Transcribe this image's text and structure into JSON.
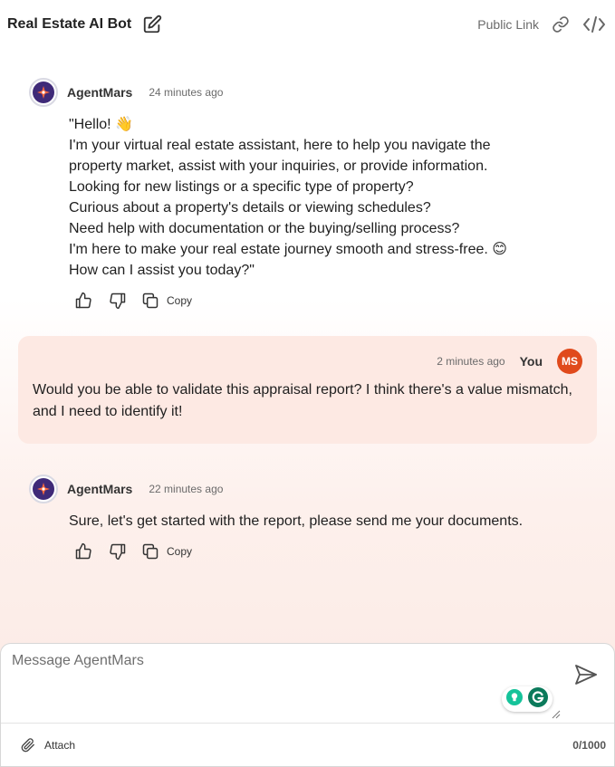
{
  "header": {
    "title": "Real Estate AI Bot",
    "public_link": "Public Link"
  },
  "messages": [
    {
      "author": "AgentMars",
      "time": "24 minutes ago",
      "lines": [
        "\"Hello! 👋",
        "I'm your virtual real estate assistant, here to help you navigate the",
        "property market, assist with your inquiries, or provide information.",
        "Looking for new listings or a specific type of property?",
        "Curious about a property's details or viewing schedules?",
        "Need help with documentation or the buying/selling process?",
        "I'm here to make your real estate journey smooth and stress-free. 😊",
        "How can I assist you today?\""
      ],
      "copy_label": "Copy"
    },
    {
      "author": "You",
      "initials": "MS",
      "time": "2 minutes ago",
      "text": "Would you be able to validate this appraisal report? I think there's a value mismatch, and I need to identify it!"
    },
    {
      "author": "AgentMars",
      "time": "22 minutes ago",
      "lines": [
        "Sure, let's get started with the report, please send me your documents."
      ],
      "copy_label": "Copy"
    }
  ],
  "composer": {
    "placeholder": "Message AgentMars",
    "attach_label": "Attach",
    "counter": "0/1000"
  },
  "colors": {
    "user_card_bg": "#fde9e3",
    "user_avatar": "#e04a1c",
    "bot_avatar": "#3f2a78"
  },
  "icons": [
    "edit-icon",
    "link-icon",
    "code-icon",
    "thumbs-up-icon",
    "thumbs-down-icon",
    "copy-icon",
    "send-icon",
    "paperclip-icon",
    "grammarly-icon"
  ]
}
